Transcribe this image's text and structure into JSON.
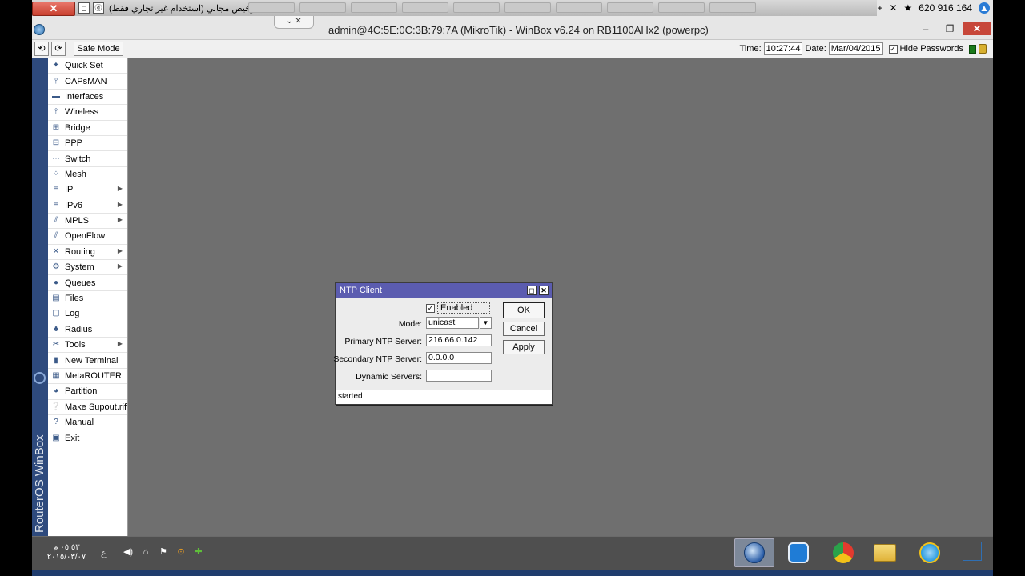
{
  "remote_bar": {
    "close_label": "✕",
    "mini_a": "◻",
    "mini_b": "ⓓ",
    "title": "ترخيص مجاني (استخدام غير تجاري فقط)",
    "add_icon": "+",
    "star_icon": "★",
    "session_id": "620 916 164",
    "up_icon": "▲"
  },
  "window": {
    "title": "admin@4C:5E:0C:3B:79:7A (MikroTik) - WinBox v6.24 on RB1100AHx2 (powerpc)",
    "chevrons": "⌄ ✕",
    "minimize": "–",
    "restore": "❐",
    "close": "✕"
  },
  "toolbar": {
    "undo": "⟲",
    "redo": "⟳",
    "safe_mode": "Safe Mode",
    "time_label": "Time:",
    "time_value": "10:27:44",
    "date_label": "Date:",
    "date_value": "Mar/04/2015",
    "hide_passwords_checked": "✓",
    "hide_passwords_label": "Hide Passwords"
  },
  "sidebar": {
    "vertical_label": "RouterOS WinBox",
    "items": [
      {
        "label": "Quick Set",
        "icon": "✦",
        "submenu": ""
      },
      {
        "label": "CAPsMAN",
        "icon": "⫯",
        "submenu": ""
      },
      {
        "label": "Interfaces",
        "icon": "▬",
        "submenu": ""
      },
      {
        "label": "Wireless",
        "icon": "⫯",
        "submenu": ""
      },
      {
        "label": "Bridge",
        "icon": "⊞",
        "submenu": ""
      },
      {
        "label": "PPP",
        "icon": "⊟",
        "submenu": ""
      },
      {
        "label": "Switch",
        "icon": "⋯",
        "submenu": ""
      },
      {
        "label": "Mesh",
        "icon": "⁘",
        "submenu": ""
      },
      {
        "label": "IP",
        "icon": "≡",
        "submenu": "▶"
      },
      {
        "label": "IPv6",
        "icon": "≡",
        "submenu": "▶"
      },
      {
        "label": "MPLS",
        "icon": "⫽",
        "submenu": "▶"
      },
      {
        "label": "OpenFlow",
        "icon": "⫽",
        "submenu": ""
      },
      {
        "label": "Routing",
        "icon": "✕",
        "submenu": "▶"
      },
      {
        "label": "System",
        "icon": "⚙",
        "submenu": "▶"
      },
      {
        "label": "Queues",
        "icon": "●",
        "submenu": ""
      },
      {
        "label": "Files",
        "icon": "▤",
        "submenu": ""
      },
      {
        "label": "Log",
        "icon": "▢",
        "submenu": ""
      },
      {
        "label": "Radius",
        "icon": "♣",
        "submenu": ""
      },
      {
        "label": "Tools",
        "icon": "✂",
        "submenu": "▶"
      },
      {
        "label": "New Terminal",
        "icon": "▮",
        "submenu": ""
      },
      {
        "label": "MetaROUTER",
        "icon": "▦",
        "submenu": ""
      },
      {
        "label": "Partition",
        "icon": "◕",
        "submenu": ""
      },
      {
        "label": "Make Supout.rif",
        "icon": "❔",
        "submenu": ""
      },
      {
        "label": "Manual",
        "icon": "?",
        "submenu": ""
      },
      {
        "label": "Exit",
        "icon": "▣",
        "submenu": ""
      }
    ]
  },
  "ntp_dialog": {
    "title": "NTP Client",
    "restore": "◻",
    "close": "✕",
    "enabled_check": "✓",
    "enabled_label": "Enabled",
    "mode_label": "Mode:",
    "mode_value": "unicast",
    "mode_dropdown": "▼",
    "primary_label": "Primary NTP Server:",
    "primary_value": "216.66.0.142",
    "secondary_label": "Secondary NTP Server:",
    "secondary_value": "0.0.0.0",
    "dynamic_label": "Dynamic Servers:",
    "dynamic_value": "",
    "ok": "OK",
    "cancel": "Cancel",
    "apply": "Apply",
    "status": "started"
  },
  "taskbar": {
    "clock_time": "٠٥:٥٣ م",
    "clock_date": "٢٠١٥/٠٣/٠٧",
    "language": "ع",
    "tray": [
      "◀)",
      "⌂",
      "⚑",
      "⊙",
      "✚"
    ],
    "apps": [
      "winbox-icon",
      "teamviewer-icon",
      "chrome-icon",
      "folder-icon",
      "ie-icon"
    ],
    "colors": {
      "winbox": "#2b5ea8",
      "teamviewer": "#1f7cd6",
      "chrome": "#e23a2e",
      "folder": "#e9c14a",
      "ie": "#2a9be0"
    }
  },
  "colors": {
    "desktop": "#6f6f6f",
    "dialog_title": "#5b5cb0",
    "sidebar_bar": "#2e4a7d"
  }
}
